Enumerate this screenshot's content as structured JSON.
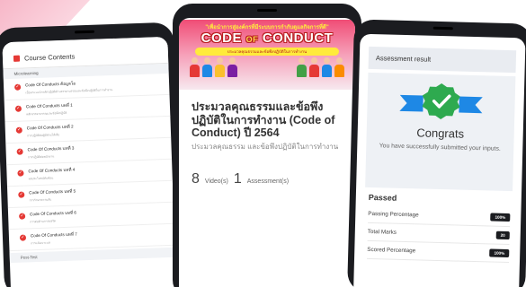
{
  "left": {
    "header": "Course Contents",
    "section": "Microlearning",
    "items": [
      {
        "title": "Code Of Conducts ค้อมูลโอ",
        "sub": "เนื้อหาแนะนำหลักปฏิบัติด้านจรรยาบรรณและข้อพึงปฏิบัติในการทำงาน"
      },
      {
        "title": "Code Of Conducts บทที่ 1",
        "sub": "หลักจรรยาบรรณและข้อพึงปฏิบัติ"
      },
      {
        "title": "Code Of Conducts บทที่ 2",
        "sub": "การปฏิบัติต่อผู้มีส่วนได้เสีย"
      },
      {
        "title": "Code Of Conducts บทที่ 3",
        "sub": "การปฏิบัติต่อพนักงาน"
      },
      {
        "title": "Code Of Conducts บทที่ 4",
        "sub": "ผลประโยชน์ทับซ้อน"
      },
      {
        "title": "Code Of Conducts บทที่ 5",
        "sub": "การรักษาความลับ"
      },
      {
        "title": "Code Of Conducts บทที่ 6",
        "sub": "การต่อต้านการทุจริต"
      },
      {
        "title": "Code Of Conducts บทที่ 7",
        "sub": "การแจ้งเบาะแส"
      }
    ],
    "post": "Post-Test"
  },
  "middle": {
    "banner_top": "\"เพื่อนำการสู่องค์กรที่มีระบบการกำกับดูแลกิจการที่ดี\"",
    "banner_code": "CODE",
    "banner_of": "OF",
    "banner_conduct": "CONDUCT",
    "banner_sub": "ประมวลคุณธรรมและข้อพึงปฏิบัติในการทำงาน",
    "title": "ประมวลคุณธรรมและข้อพึงปฏิบัติในการทำงาน (Code of Conduct) ปี 2564",
    "desc": "ประมวลคุณธรรม และข้อพึงปฏิบัติในการทำงาน",
    "videos_n": "8",
    "videos_l": "Video(s)",
    "assess_n": "1",
    "assess_l": "Assessment(s)"
  },
  "right": {
    "header": "Assessment result",
    "congrats": "Congrats",
    "message": "You have successfully submitted your inputs.",
    "passed": "Passed",
    "rows": [
      {
        "label": "Passing Percentage",
        "value": "100%"
      },
      {
        "label": "Total Marks",
        "value": "20"
      },
      {
        "label": "Scored Percentage",
        "value": "100%"
      }
    ]
  },
  "colors": {
    "accent": "#e53935",
    "badge": "#2eaa4f",
    "ribbon": "#1e88e5",
    "pink": "#f04d76"
  }
}
